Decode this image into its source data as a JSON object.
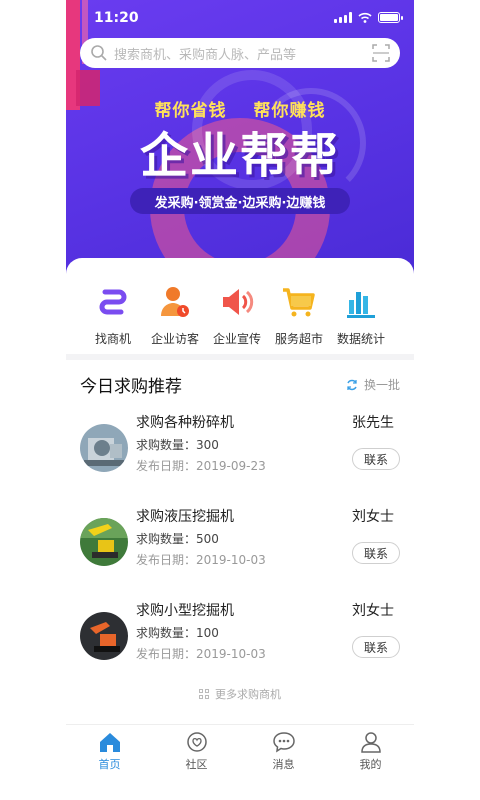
{
  "status_bar": {
    "time": "11:20"
  },
  "search": {
    "placeholder": "搜索商机、采购商人脉、产品等"
  },
  "banner": {
    "slogan_left": "帮你省钱",
    "slogan_right": "帮你赚钱",
    "headline": "企业帮帮",
    "tagline": "发采购·领赏金·边采购·边赚钱"
  },
  "quick_menu": [
    {
      "label": "找商机",
      "icon": "link-icon"
    },
    {
      "label": "企业访客",
      "icon": "visitor-icon"
    },
    {
      "label": "企业宣传",
      "icon": "megaphone-icon"
    },
    {
      "label": "服务超市",
      "icon": "cart-icon"
    },
    {
      "label": "数据统计",
      "icon": "bar-chart-icon"
    }
  ],
  "section": {
    "title": "今日求购推荐",
    "refresh_label": "换一批"
  },
  "purchases": [
    {
      "title": "求购各种粉碎机",
      "quantity": "求购数量：300",
      "date": "发布日期：2019-09-23",
      "contact": "张先生",
      "button": "联系"
    },
    {
      "title": "求购液压挖掘机",
      "quantity": "求购数量：500",
      "date": "发布日期：2019-10-03",
      "contact": "刘女士",
      "button": "联系"
    },
    {
      "title": "求购小型挖掘机",
      "quantity": "求购数量：100",
      "date": "发布日期：2019-10-03",
      "contact": "刘女士",
      "button": "联系"
    }
  ],
  "more_label": "更多求购商机",
  "tabs": [
    {
      "label": "首页",
      "icon": "home-icon",
      "active": true
    },
    {
      "label": "社区",
      "icon": "community-icon",
      "active": false
    },
    {
      "label": "消息",
      "icon": "message-icon",
      "active": false
    },
    {
      "label": "我的",
      "icon": "profile-icon",
      "active": false
    }
  ],
  "colors": {
    "accent": "#2a8bdc",
    "hero": "#5b34e6",
    "slogan": "#ffe15a"
  }
}
